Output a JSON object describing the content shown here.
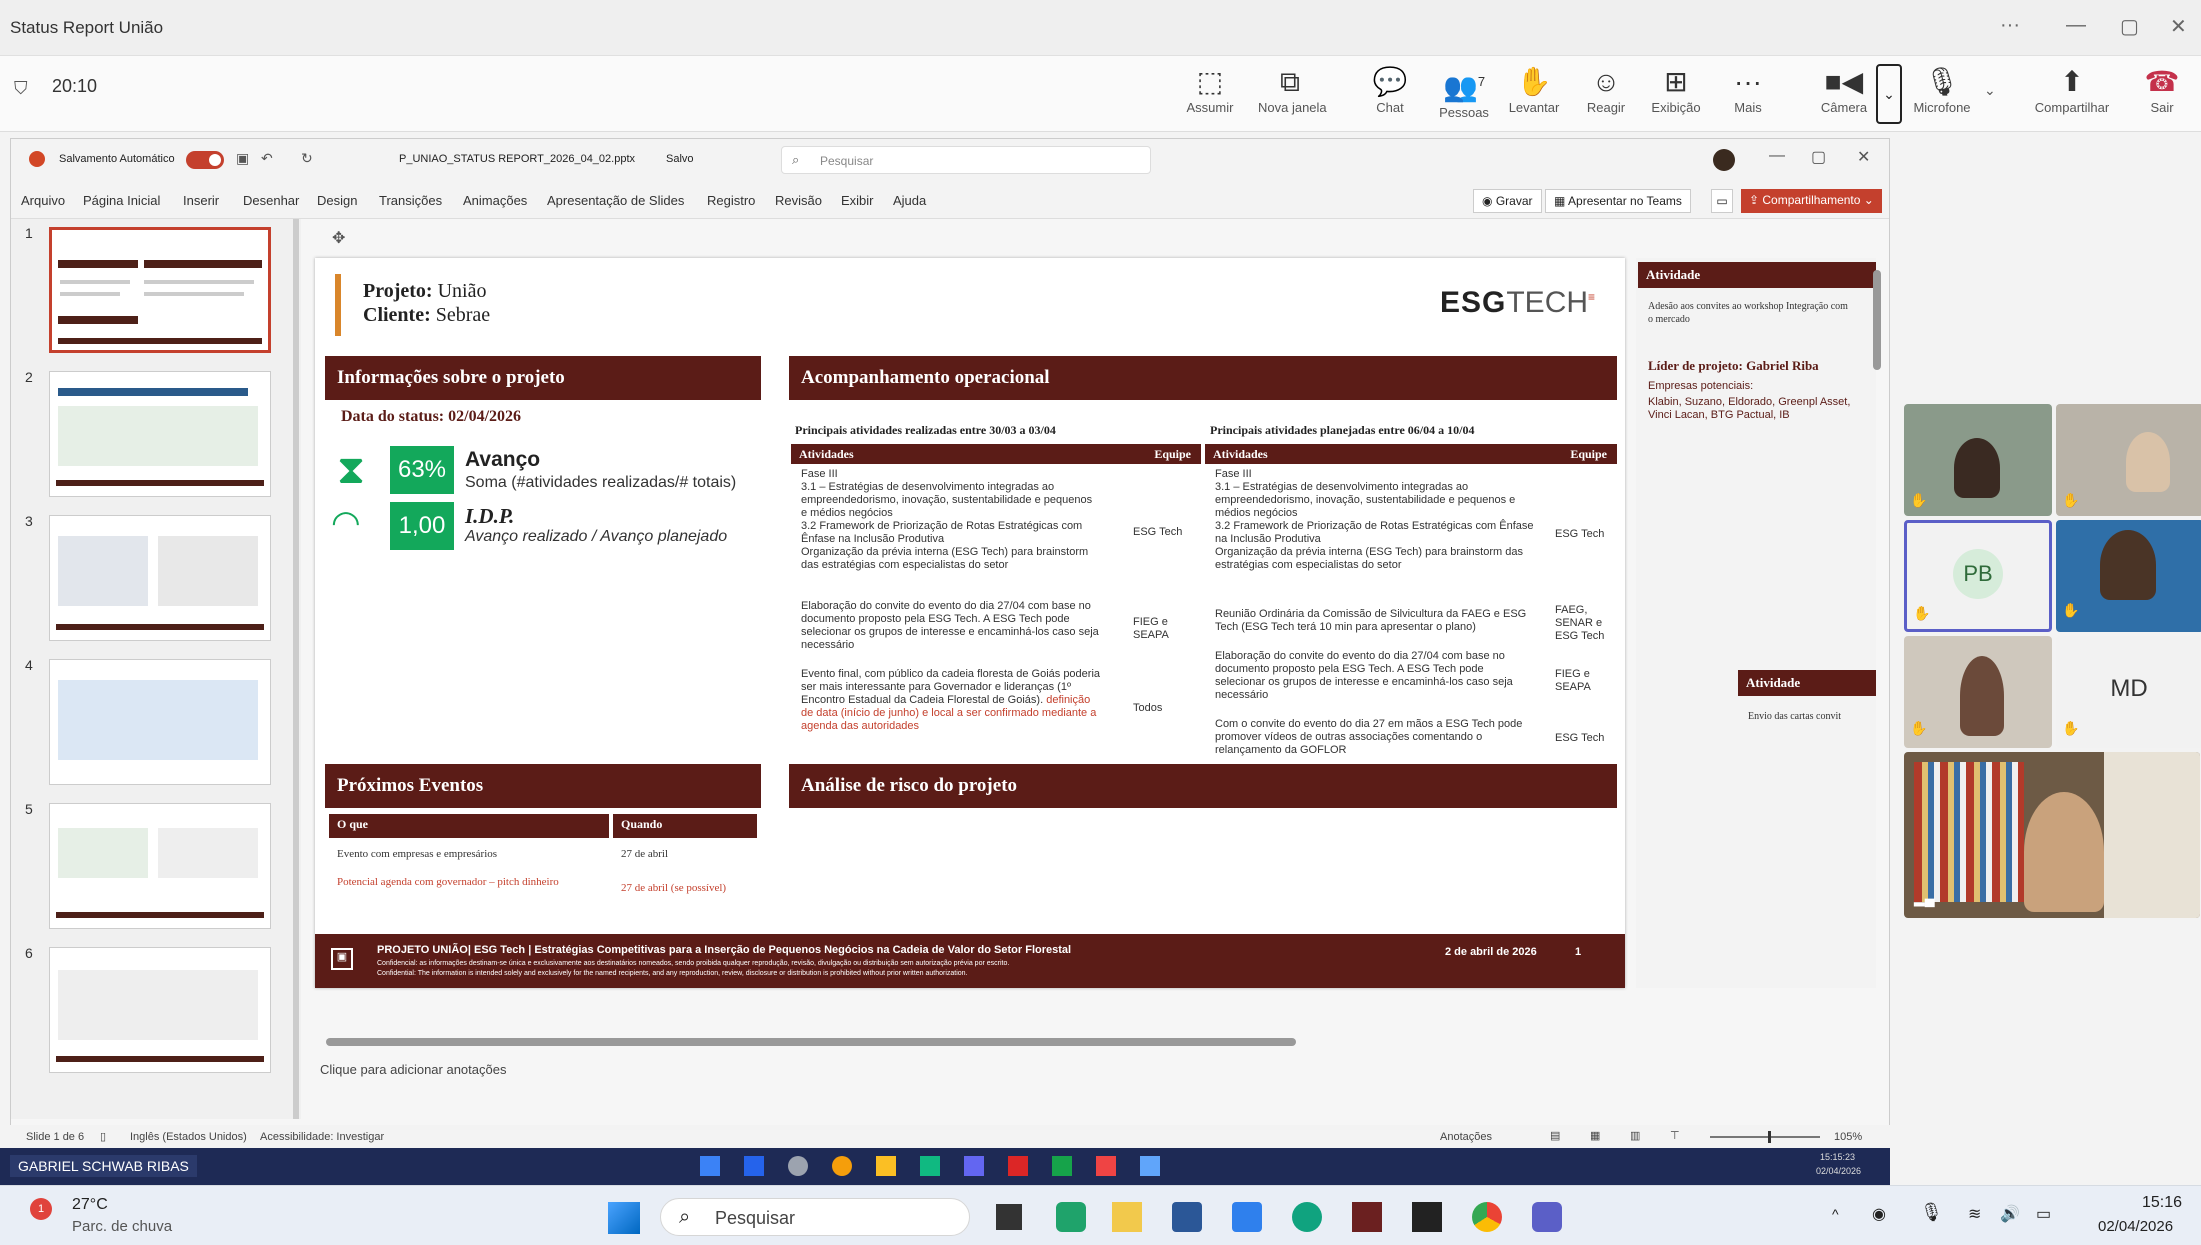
{
  "teams": {
    "window_title": "Status Report União",
    "timer": "20:10",
    "toolbar": [
      {
        "label": "Assumir",
        "icon": "take-control-icon"
      },
      {
        "label": "Nova janela",
        "icon": "new-window-icon"
      },
      {
        "label": "Chat",
        "icon": "chat-icon"
      },
      {
        "label": "Pessoas",
        "icon": "people-icon",
        "count": "7"
      },
      {
        "label": "Levantar",
        "icon": "raise-hand-icon"
      },
      {
        "label": "Reagir",
        "icon": "react-icon"
      },
      {
        "label": "Exibição",
        "icon": "view-icon"
      },
      {
        "label": "Mais",
        "icon": "more-icon"
      },
      {
        "label": "Câmera",
        "icon": "camera-icon"
      },
      {
        "label": "Microfone",
        "icon": "microphone-off-icon"
      },
      {
        "label": "Compartilhar",
        "icon": "share-icon"
      },
      {
        "label": "Sair",
        "icon": "hang-up-icon"
      }
    ],
    "participants": [
      {
        "initials": ""
      },
      {
        "initials": ""
      },
      {
        "initials": "PB"
      },
      {
        "initials": ""
      },
      {
        "initials": ""
      },
      {
        "initials": "MD"
      },
      {
        "initials": ""
      }
    ],
    "presenter_name": "GABRIEL SCHWAB RIBAS"
  },
  "ppt": {
    "autosave": "Salvamento Automático",
    "filename": "P_UNIAO_STATUS REPORT_2026_04_02.pptx",
    "saved": "Salvo",
    "search_placeholder": "Pesquisar",
    "menu": [
      "Arquivo",
      "Página Inicial",
      "Inserir",
      "Desenhar",
      "Design",
      "Transições",
      "Animações",
      "Apresentação de Slides",
      "Registro",
      "Revisão",
      "Exibir",
      "Ajuda"
    ],
    "record": "Gravar",
    "present_teams": "Apresentar no Teams",
    "share": "Compartilhamento",
    "thumbs": [
      "1",
      "2",
      "3",
      "4",
      "5",
      "6"
    ],
    "notes_placeholder": "Clique para adicionar anotações",
    "status_left": "Slide 1 de 6",
    "status_lang": "Inglês (Estados Unidos)",
    "status_access": "Acessibilidade: Investigar",
    "status_notes": "Anotações",
    "zoom": "105%"
  },
  "slide": {
    "project_label": "Projeto:",
    "project_value": "União",
    "client_label": "Cliente:",
    "client_value": "Sebrae",
    "logo_bold": "ESG",
    "logo_light": "TECH",
    "info_header": "Informações sobre o projeto",
    "status_date": "Data do status: 02/04/2026",
    "advance_pct": "63%",
    "advance_title": "Avanço",
    "advance_desc": "Soma (#atividades realizadas/# totais)",
    "idp_value": "1,00",
    "idp_title": "I.D.P.",
    "idp_desc": "Avanço realizado / Avanço planejado",
    "ops_header": "Acompanhamento operacional",
    "done_title": "Principais atividades realizadas entre 30/03 a 03/04",
    "planned_title": "Principais atividades planejadas entre 06/04 a 10/04",
    "col_activities": "Atividades",
    "col_team": "Equipe",
    "done_rows": [
      {
        "text": "Fase III\n3.1 – Estratégias de desenvolvimento integradas ao empreendedorismo, inovação, sustentabilidade e pequenos e médios negócios\n3.2 Framework de Priorização de Rotas Estratégicas com Ênfase na Inclusão Produtiva\nOrganização da prévia interna (ESG Tech) para brainstorm das estratégias com especialistas do setor",
        "team": "ESG Tech"
      },
      {
        "text": "Elaboração do convite do evento do dia 27/04 com base no documento proposto pela ESG Tech. A ESG Tech pode selecionar os grupos de interesse e encaminhá-los caso seja necessário",
        "team": "FIEG e SEAPA"
      },
      {
        "text": "Evento final, com público da cadeia floresta de Goiás poderia ser mais interessante para Governador e lideranças (1º Encontro Estadual da Cadeia Florestal de Goiás).",
        "red": "definição de data (início de junho) e local a ser confirmado mediante a agenda das autoridades",
        "team": "Todos"
      }
    ],
    "planned_rows": [
      {
        "text": "Fase III\n3.1 – Estratégias de desenvolvimento integradas ao empreendedorismo, inovação, sustentabilidade e pequenos e médios negócios\n3.2 Framework de Priorização de Rotas Estratégicas com Ênfase na Inclusão Produtiva\nOrganização da prévia interna (ESG Tech) para brainstorm das estratégias com especialistas do setor",
        "team": "ESG Tech"
      },
      {
        "text": "Reunião Ordinária da Comissão de Silvicultura da FAEG e ESG Tech (ESG Tech terá 10 min para apresentar o plano)",
        "team": "FAEG, SENAR e ESG Tech"
      },
      {
        "text": "Elaboração do convite do evento do dia 27/04 com base no documento proposto pela ESG Tech. A ESG Tech pode selecionar os grupos de interesse e encaminhá-los caso seja necessário",
        "team": "FIEG e SEAPA"
      },
      {
        "text": "Com o convite do evento do dia 27 em mãos a ESG Tech pode promover vídeos de outras associações comentando o relançamento da GOFLOR",
        "team": "ESG Tech"
      }
    ],
    "events_header": "Próximos Eventos",
    "events_col_what": "O que",
    "events_col_when": "Quando",
    "events": [
      {
        "what": "Evento com empresas e empresários",
        "when": "27 de abril",
        "red": false
      },
      {
        "what": "Potencial agenda com governador – pitch dinheiro",
        "when": "27 de abril (se possível)",
        "red": true
      }
    ],
    "risk_header": "Análise de risco do projeto",
    "footer_title": "PROJETO UNIÃO| ESG Tech | Estratégias Competitivas para a Inserção de Pequenos Negócios na Cadeia de Valor do Setor Florestal",
    "footer_pt": "Confidencial: as informações destinam-se única e exclusivamente aos destinatários nomeados, sendo proibida qualquer reprodução, revisão, divulgação ou distribuição sem autorização prévia por escrito.",
    "footer_en": "Confidential: The information is intended solely and exclusively for the named recipients, and any reproduction, review, disclosure or distribution is prohibited without prior written authorization.",
    "footer_date": "2 de abril de 2026",
    "footer_page": "1"
  },
  "side": {
    "activity_header": "Atividade",
    "activity_text": "Adesão aos convites ao workshop Integração com o mercado",
    "leader": "Líder de projeto: Gabriel Riba",
    "companies_label": "Empresas potenciais:",
    "companies": "Klabin, Suzano, Eldorado, Greenpl Asset, Vinci Lacan, BTG Pactual, IB",
    "activity_header2": "Atividade",
    "activity_text2": "Envio das cartas convit"
  },
  "taskbar": {
    "weather_temp": "27°C",
    "weather_desc": "Parc. de chuva",
    "search": "Pesquisar",
    "time": "15:16",
    "date": "02/04/2026",
    "vm_time": "15:15:23",
    "vm_date": "02/04/2026"
  }
}
